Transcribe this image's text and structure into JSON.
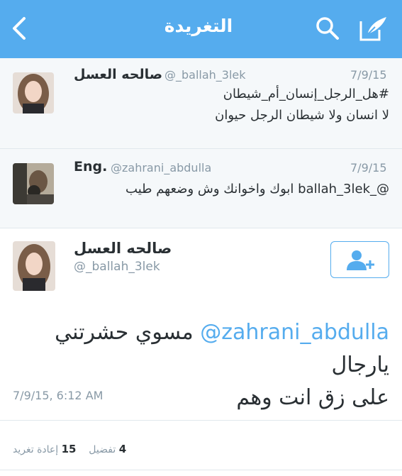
{
  "header": {
    "title": "التغريدة",
    "color": "#55acee",
    "icons": {
      "back": "chevron-left-icon",
      "search": "search-icon",
      "compose": "compose-icon"
    }
  },
  "replies": [
    {
      "name": "صالحه العسل",
      "handle": "@_ballah_3lek",
      "time": "7/9/15",
      "lines": [
        "#هل_الرجل_إنسان_أم_شيطان",
        "لا انسان ولا شيطان الرجل حيوان"
      ]
    },
    {
      "name": "Eng.",
      "handle": "@zahrani_abdulla",
      "time": "7/9/15",
      "lines": [
        "@_ballah_3lek ابوك واخوانك وش وضعهم طيب"
      ]
    }
  ],
  "main_tweet": {
    "name": "صالحه العسل",
    "handle": "@_ballah_3lek",
    "mention": "@zahrani_abdulla",
    "text_line1": "مسوي حشرتني يارجال",
    "text_line2": "على زق انت وهم",
    "timestamp": "7/9/15, 6:12 AM",
    "retweets_count": "15",
    "retweets_label": "إعادة تغريد",
    "likes_count": "4",
    "likes_label": "تفضيل",
    "follow_icon": "add-user-icon"
  },
  "colors": {
    "accent": "#55acee",
    "secondary_text": "#8899a6",
    "primary_text": "#292f33"
  }
}
